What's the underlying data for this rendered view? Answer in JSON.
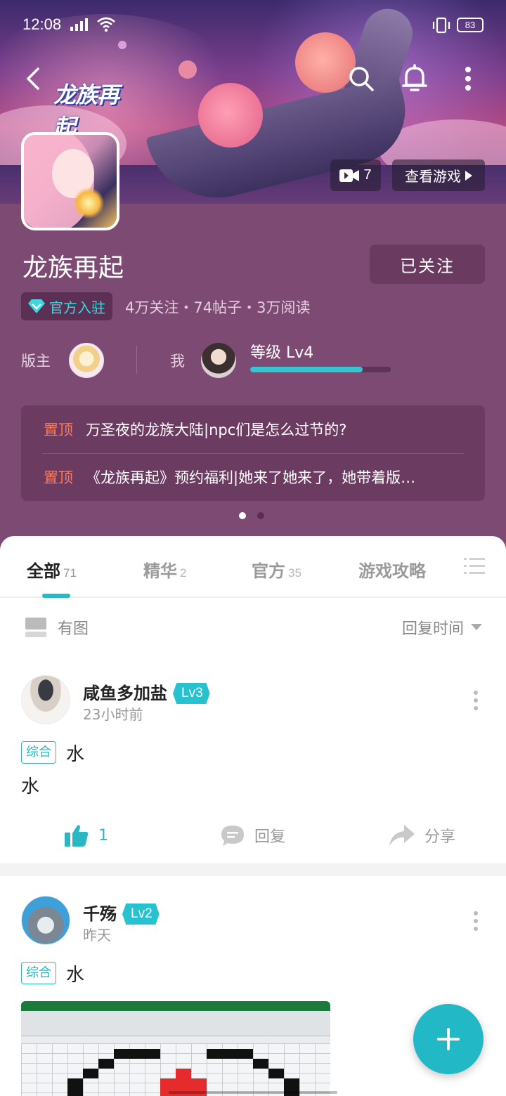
{
  "status_bar": {
    "time": "12:08",
    "battery": "83"
  },
  "header": {
    "game_logo_text": "龙族再起",
    "video_count": "7",
    "view_game_label": "查看游戏"
  },
  "forum": {
    "title": "龙族再起",
    "follow_button": "已关注",
    "official_badge": "官方入驻",
    "stats": "4万关注・74帖子・3万阅读",
    "moderator_label": "版主",
    "me_label": "我",
    "level_text": "等级 Lv4",
    "level_progress": 0.8
  },
  "pinned": [
    {
      "tag": "置顶",
      "title": "万圣夜的龙族大陆|npc们是怎么过节的?"
    },
    {
      "tag": "置顶",
      "title": "《龙族再起》预约福利|她来了她来了，她带着版…"
    }
  ],
  "tabs": [
    {
      "label": "全部",
      "count": "71",
      "active": true
    },
    {
      "label": "精华",
      "count": "2"
    },
    {
      "label": "官方",
      "count": "35"
    },
    {
      "label": "游戏攻略",
      "count": ""
    }
  ],
  "filter": {
    "with_images": "有图",
    "sort": "回复时间"
  },
  "posts": [
    {
      "author": "咸鱼多加盐",
      "level": "Lv3",
      "time": "23小时前",
      "category": "综合",
      "title": "水",
      "body": "水",
      "likes": "1",
      "reply_label": "回复",
      "share_label": "分享"
    },
    {
      "author": "千殇",
      "level": "Lv2",
      "time": "昨天",
      "category": "综合",
      "title": "水"
    }
  ],
  "colors": {
    "accent": "#22b8c6",
    "header_bg": "#7d4a73",
    "pin_tag": "#ff7a58"
  }
}
